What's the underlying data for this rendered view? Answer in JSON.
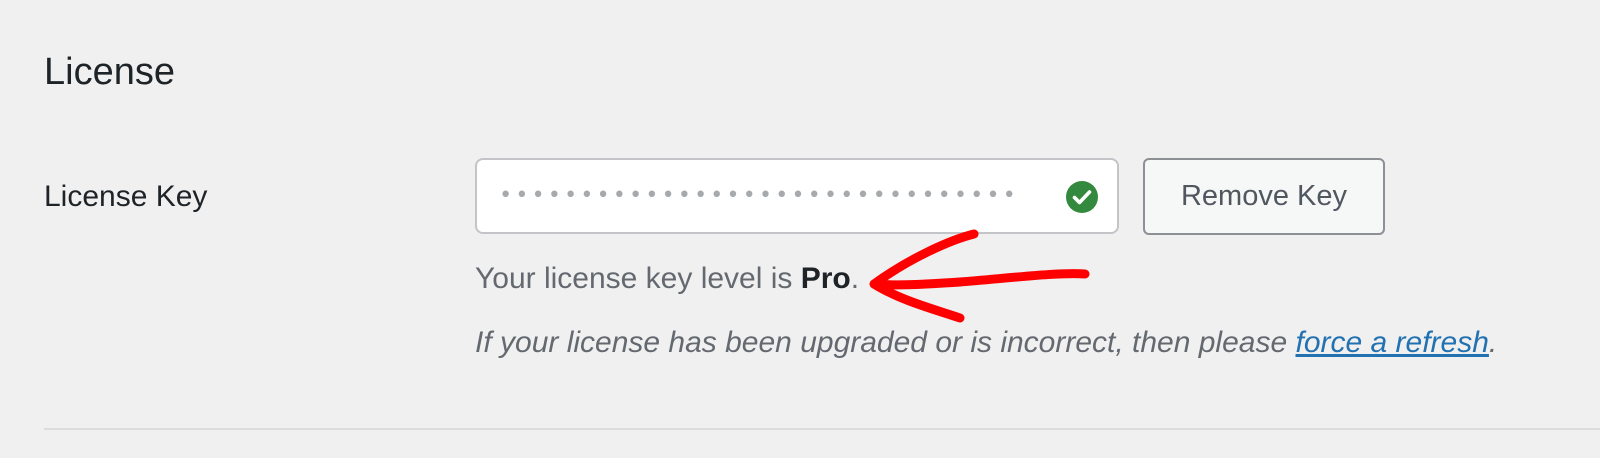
{
  "section": {
    "title": "License"
  },
  "license_field": {
    "label": "License Key",
    "masked_value": "••••••••••••••••••••••••••••••••",
    "status_icon": "check-circle-icon",
    "status_color": "#338a3e"
  },
  "remove_button": {
    "label": "Remove Key"
  },
  "level": {
    "prefix": "Your license key level is ",
    "value": "Pro",
    "suffix": "."
  },
  "refresh": {
    "prefix": "If your license has been upgraded or is incorrect, then please ",
    "link_text": "force a refresh",
    "suffix": "."
  },
  "annotation": {
    "icon": "red-arrow-annotation",
    "color": "#ff0000"
  }
}
